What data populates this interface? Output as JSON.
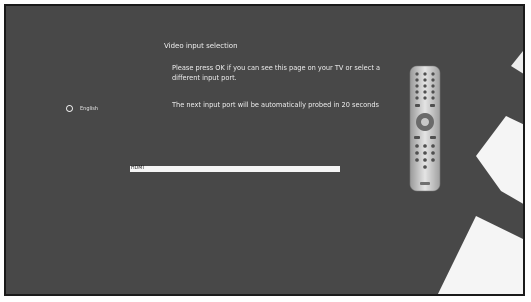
{
  "page": {
    "title": "Video input selection",
    "message_1": "Please press OK if you can see this page on your TV or select a different input port.",
    "message_2": "The next input port will be automatically probed in 20 seconds"
  },
  "language": {
    "label": "English"
  },
  "input_port": {
    "label": "HDMI",
    "progress": 1.0
  },
  "icons": {
    "remote": "remote-control-icon",
    "radio": "radio-button-icon"
  },
  "colors": {
    "background": "#484848",
    "text": "#f0f0f0",
    "bar": "#f5f5f5"
  }
}
